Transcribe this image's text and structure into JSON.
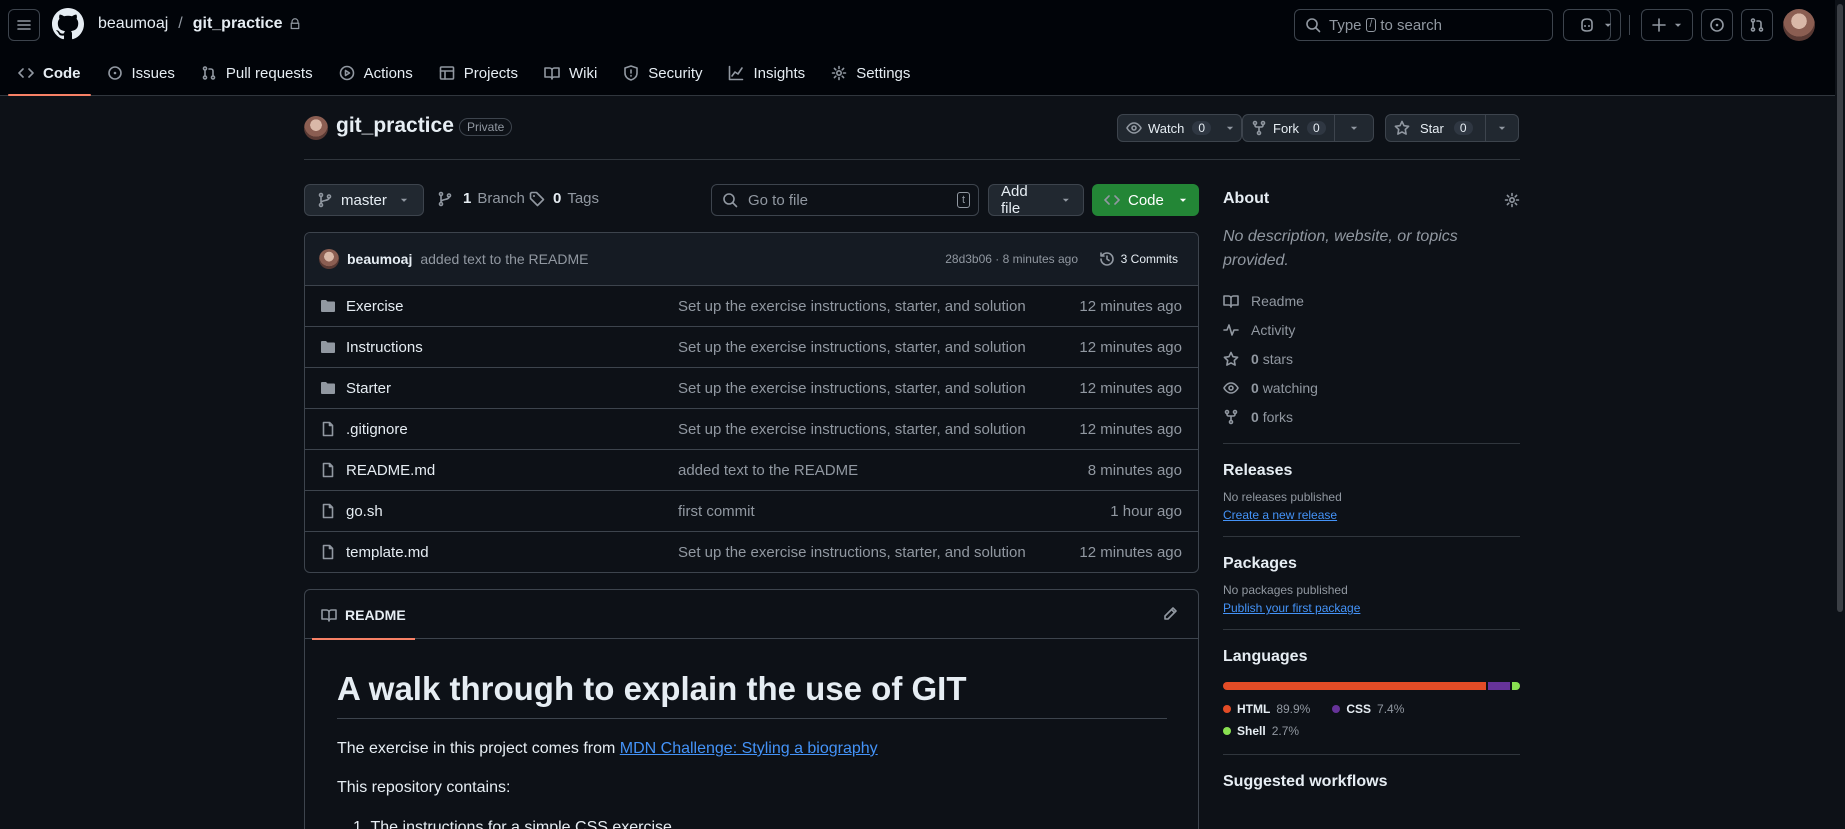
{
  "header": {
    "owner": "beaumoaj",
    "separator": "/",
    "repo": "git_practice",
    "search_prefix": "Type",
    "search_key": "/",
    "search_suffix": "to search"
  },
  "repo_nav": [
    {
      "label": "Code",
      "icon": "code-icon"
    },
    {
      "label": "Issues",
      "icon": "issue-icon"
    },
    {
      "label": "Pull requests",
      "icon": "pull-request-icon"
    },
    {
      "label": "Actions",
      "icon": "play-icon"
    },
    {
      "label": "Projects",
      "icon": "table-icon"
    },
    {
      "label": "Wiki",
      "icon": "book-icon"
    },
    {
      "label": "Security",
      "icon": "shield-icon"
    },
    {
      "label": "Insights",
      "icon": "graph-icon"
    },
    {
      "label": "Settings",
      "icon": "gear-icon"
    }
  ],
  "repo_header": {
    "name": "git_practice",
    "visibility": "Private",
    "watch_label": "Watch",
    "watch_count": "0",
    "fork_label": "Fork",
    "fork_count": "0",
    "star_label": "Star",
    "star_count": "0"
  },
  "toolbar": {
    "branch": "master",
    "branch_count": "1",
    "branch_label": "Branch",
    "tag_count": "0",
    "tag_label": "Tags",
    "go_to_file": "Go to file",
    "go_to_file_key": "t",
    "add_file": "Add file",
    "code": "Code"
  },
  "latest_commit": {
    "author": "beaumoaj",
    "message": "added text to the README",
    "meta": "28d3b06 · 8 minutes ago",
    "commits": "3 Commits"
  },
  "files": [
    {
      "type": "folder",
      "name": "Exercise",
      "message": "Set up the exercise instructions, starter, and solution",
      "time": "12 minutes ago"
    },
    {
      "type": "folder",
      "name": "Instructions",
      "message": "Set up the exercise instructions, starter, and solution",
      "time": "12 minutes ago"
    },
    {
      "type": "folder",
      "name": "Starter",
      "message": "Set up the exercise instructions, starter, and solution",
      "time": "12 minutes ago"
    },
    {
      "type": "file",
      "name": ".gitignore",
      "message": "Set up the exercise instructions, starter, and solution",
      "time": "12 minutes ago"
    },
    {
      "type": "file",
      "name": "README.md",
      "message": "added text to the README",
      "time": "8 minutes ago"
    },
    {
      "type": "file",
      "name": "go.sh",
      "message": "first commit",
      "time": "1 hour ago"
    },
    {
      "type": "file",
      "name": "template.md",
      "message": "Set up the exercise instructions, starter, and solution",
      "time": "12 minutes ago"
    }
  ],
  "readme": {
    "tab": "README",
    "title": "A walk through to explain the use of GIT",
    "p1_text": "The exercise in this project comes from ",
    "p1_link": "MDN Challenge: Styling a biography",
    "p2": "This repository contains:",
    "li1": "1. The instructions for a simple CSS exercise"
  },
  "about": {
    "title": "About",
    "description": "No description, website, or topics provided.",
    "readme": "Readme",
    "activity": "Activity",
    "stars_count": "0",
    "stars_label": "stars",
    "watching_count": "0",
    "watching_label": "watching",
    "forks_count": "0",
    "forks_label": "forks"
  },
  "releases": {
    "title": "Releases",
    "empty": "No releases published",
    "link": "Create a new release"
  },
  "packages": {
    "title": "Packages",
    "empty": "No packages published",
    "link": "Publish your first package"
  },
  "languages": {
    "title": "Languages",
    "items": [
      {
        "name": "HTML",
        "percent": "89.9%",
        "value": 89.9,
        "color": "#e34c26"
      },
      {
        "name": "CSS",
        "percent": "7.4%",
        "value": 7.4,
        "color": "#663399"
      },
      {
        "name": "Shell",
        "percent": "2.7%",
        "value": 2.7,
        "color": "#89e051"
      }
    ]
  },
  "suggested": {
    "title": "Suggested workflows"
  },
  "colors": {
    "background": "#0d1117",
    "header_bg": "#010409",
    "accent_tab": "#f78166",
    "code_button": "#238636",
    "link": "#4493f8"
  }
}
